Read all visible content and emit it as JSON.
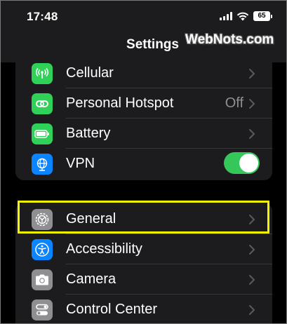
{
  "status_bar": {
    "time": "17:48",
    "battery_level": "65",
    "signal_icon": "cellular-signal-icon",
    "wifi_icon": "wifi-icon",
    "battery_icon": "battery-icon"
  },
  "nav": {
    "title": "Settings"
  },
  "watermark": {
    "text": "WebNots.com"
  },
  "colors": {
    "background": "#000000",
    "group_background": "#1c1c1e",
    "cellular_icon": "#30d158",
    "hotspot_icon": "#30d158",
    "battery_icon": "#30d158",
    "vpn_icon": "#0a84ff",
    "general_icon": "#8e8e93",
    "accessibility_icon": "#0a84ff",
    "camera_icon": "#8e8e93",
    "control_center_icon": "#8e8e93",
    "toggle_on": "#34c759",
    "highlight": "#f5f500"
  },
  "group1": {
    "rows": [
      {
        "label": "Cellular",
        "icon": "antenna-icon"
      },
      {
        "label": "Personal Hotspot",
        "value": "Off",
        "icon": "hotspot-link-icon"
      },
      {
        "label": "Battery",
        "icon": "battery-icon"
      },
      {
        "label": "VPN",
        "icon": "globe-icon",
        "toggle_on": true
      }
    ]
  },
  "group2": {
    "rows": [
      {
        "label": "General",
        "icon": "gear-icon",
        "highlighted": true
      },
      {
        "label": "Accessibility",
        "icon": "accessibility-icon"
      },
      {
        "label": "Camera",
        "icon": "camera-icon"
      },
      {
        "label": "Control Center",
        "icon": "switches-icon"
      }
    ]
  }
}
